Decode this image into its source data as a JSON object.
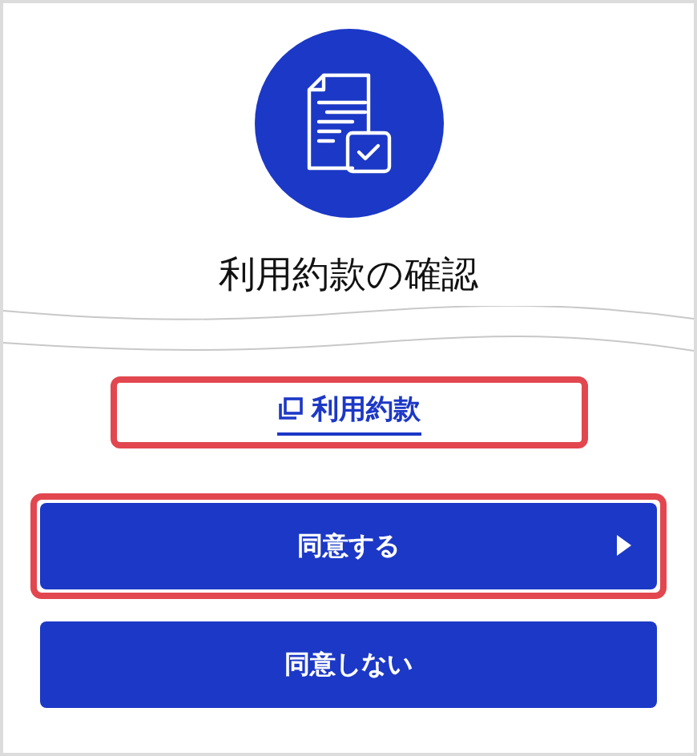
{
  "header": {
    "title": "利用約款の確認"
  },
  "link": {
    "label": "利用約款",
    "highlighted": true
  },
  "buttons": [
    {
      "label": "同意する",
      "arrow": true,
      "highlighted": true
    },
    {
      "label": "同意しない",
      "arrow": false,
      "highlighted": false
    }
  ]
}
